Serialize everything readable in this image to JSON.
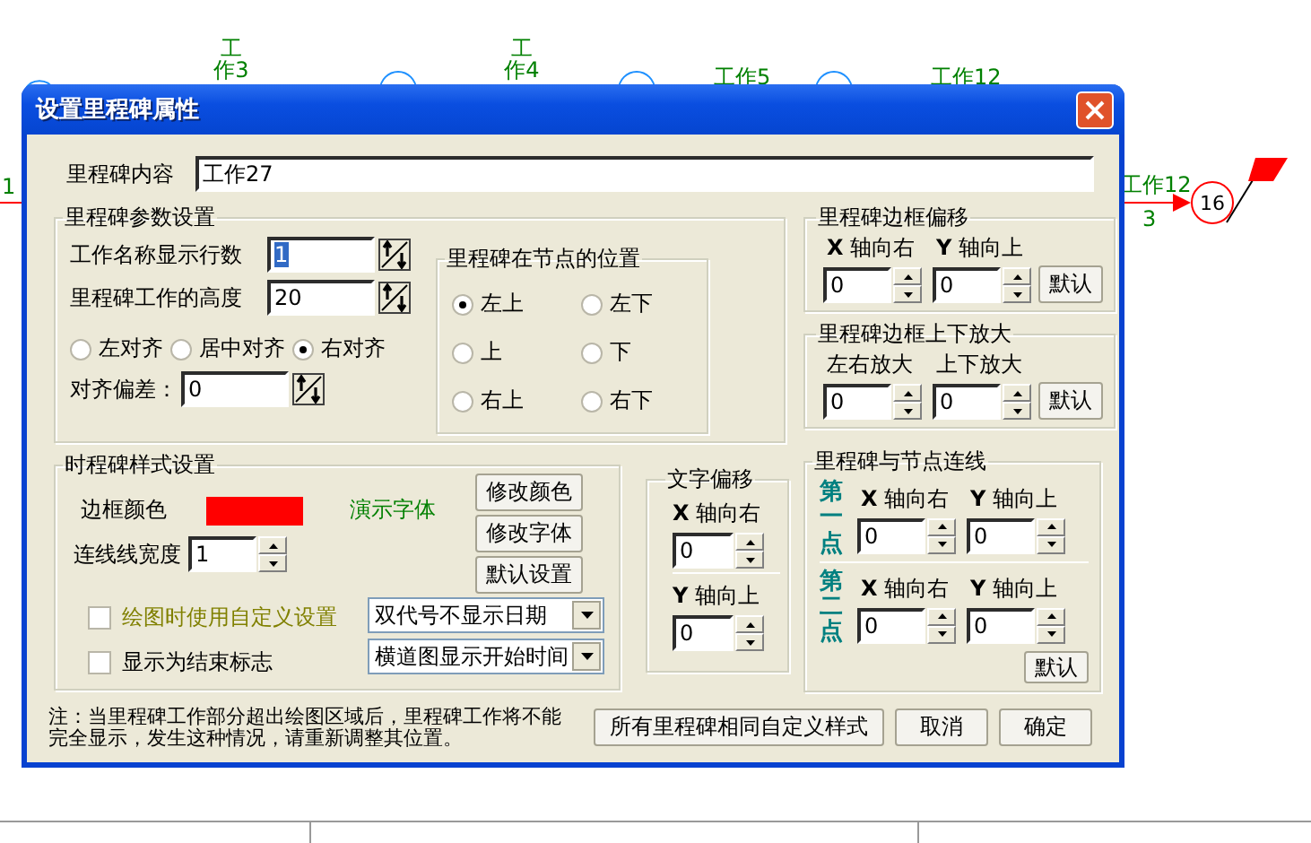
{
  "canvas": {
    "labels": [
      {
        "text": "工作3",
        "kind": "stacked"
      },
      {
        "text": "工作4",
        "kind": "stacked"
      },
      {
        "text": "工作5",
        "kind": "flat"
      },
      {
        "text": "工作12",
        "kind": "flat"
      },
      {
        "text": "工作12",
        "kind": "flat"
      },
      {
        "text": "3",
        "kind": "flat"
      },
      {
        "text": "1",
        "kind": "flat"
      }
    ],
    "node": "16"
  },
  "window": {
    "title": "设置里程碑属性"
  },
  "content": {
    "label": "里程碑内容",
    "value": "工作27"
  },
  "params": {
    "title": "里程碑参数设置",
    "fields": [
      {
        "label": "工作名称显示行数",
        "value": "1",
        "selected": true
      },
      {
        "label": "里程碑工作的高度",
        "value": "20",
        "selected": false
      }
    ],
    "align": [
      {
        "label": "左对齐",
        "selected": false
      },
      {
        "label": "居中对齐",
        "selected": false
      },
      {
        "label": "右对齐",
        "selected": true
      }
    ],
    "offset": {
      "label": "对齐偏差：",
      "value": "0"
    },
    "position": {
      "title": "里程碑在节点的位置",
      "options": [
        {
          "label": "左上",
          "selected": true
        },
        {
          "label": "左下",
          "selected": false
        },
        {
          "label": "上",
          "selected": false
        },
        {
          "label": "下",
          "selected": false
        },
        {
          "label": "右上",
          "selected": false
        },
        {
          "label": "右下",
          "selected": false
        }
      ]
    }
  },
  "style": {
    "title": "时程碑样式设置",
    "border_color": {
      "label": "边框颜色",
      "color": "#ff0000"
    },
    "sample": "演示字体",
    "line_width": {
      "label": "连线线宽度",
      "value": "1"
    },
    "buttons": [
      "修改颜色",
      "修改字体",
      "默认设置"
    ],
    "checks": [
      {
        "label": "绘图时使用自定义设置",
        "checked": false,
        "disabled": true
      },
      {
        "label": "显示为结束标志",
        "checked": false,
        "disabled": false
      }
    ],
    "selects": [
      "双代号不显示日期",
      "横道图显示开始时间"
    ]
  },
  "text_offset": {
    "title": "文字偏移",
    "fields": [
      {
        "label": "**X** 轴向右",
        "value": "0"
      },
      {
        "label": "**Y** 轴向上",
        "value": "0"
      }
    ]
  },
  "border_offset": {
    "title": "里程碑边框偏移",
    "fields": [
      {
        "label": "**X** 轴向右",
        "value": "0"
      },
      {
        "label": "**Y** 轴向上",
        "value": "0"
      }
    ],
    "button": "默认"
  },
  "border_scale": {
    "title": "里程碑边框上下放大",
    "fields": [
      {
        "label": "左右放大",
        "value": "0"
      },
      {
        "label": "上下放大",
        "value": "0"
      }
    ],
    "button": "默认"
  },
  "link": {
    "title": "里程碑与节点连线",
    "points": [
      {
        "label": "第一点",
        "fields": [
          {
            "label": "**X** 轴向右",
            "value": "0"
          },
          {
            "label": "**Y** 轴向上",
            "value": "0"
          }
        ]
      },
      {
        "label": "第二点",
        "fields": [
          {
            "label": "**X** 轴向右",
            "value": "0"
          },
          {
            "label": "**Y** 轴向上",
            "value": "0"
          }
        ]
      }
    ],
    "button": "默认"
  },
  "note": "注：当里程碑工作部分超出绘图区域后，里程碑工作将不能完全显示，发生这种情况，请重新调整其位置。",
  "buttons": [
    "所有里程碑相同自定义样式",
    "取消",
    "确定"
  ]
}
